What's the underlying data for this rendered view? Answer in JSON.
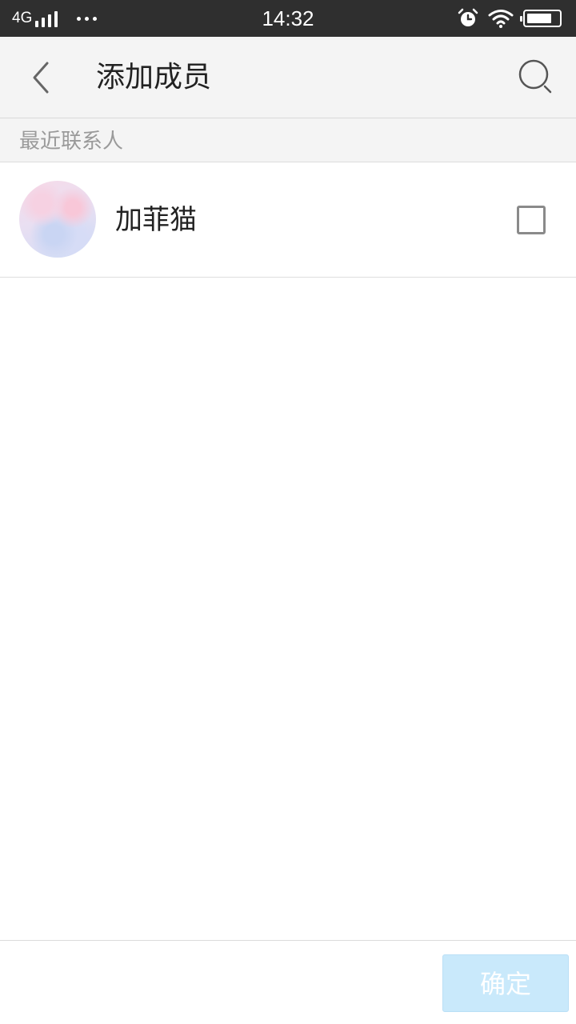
{
  "status_bar": {
    "network": "4G",
    "time": "14:32",
    "icons": [
      "signal-icon",
      "more-dots-icon",
      "alarm-icon",
      "wifi-icon",
      "battery-icon"
    ]
  },
  "header": {
    "title": "添加成员",
    "back_icon": "chevron-left-icon",
    "search_icon": "search-icon"
  },
  "section": {
    "label": "最近联系人"
  },
  "contacts": [
    {
      "name": "加菲猫",
      "checked": false
    }
  ],
  "footer": {
    "confirm_label": "确定"
  },
  "colors": {
    "status_bar_bg": "#2f2f2f",
    "header_bg": "#f4f4f4",
    "confirm_disabled_bg": "#c9e9fb",
    "secondary_text": "#9a9a9a"
  }
}
